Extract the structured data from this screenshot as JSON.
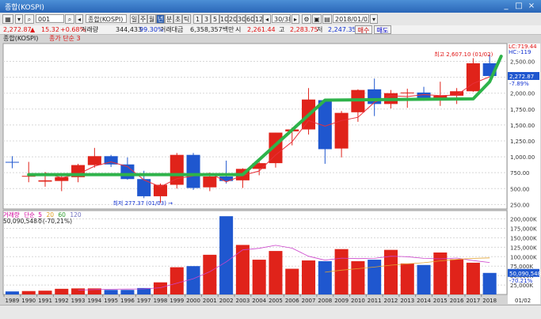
{
  "window": {
    "title": "종합(KOSPI)"
  },
  "toolbar": {
    "code_value": "001",
    "name_value": "종합(KOSPI)",
    "period_buttons": [
      "일",
      "주",
      "월",
      "년",
      "분",
      "초",
      "틱"
    ],
    "num_buttons": [
      "1",
      "3",
      "5",
      "10",
      "20",
      "30",
      "60",
      "120"
    ],
    "count_value": "30/38",
    "date_value": "2018/01/02"
  },
  "info": {
    "price": "2,272.87",
    "change_arrow": "▲",
    "change": "15.32",
    "pct": "+0.68%",
    "volume_label": "거래량",
    "volume": "344,433",
    "ratio": "99.30%",
    "amount_label": "거래대금",
    "amount": "6,358,357백만",
    "open_label": "시",
    "open": "2,261.44",
    "high_label": "고",
    "high": "2,283.75",
    "low_label": "저",
    "low": "2,247.35",
    "buy_button": "매수",
    "sell_button": "매도"
  },
  "legend": {
    "title": "종합(KOSPI)",
    "ma": "종가 단순 3"
  },
  "volume_legend": {
    "name": "거래량",
    "ma_label": "단순",
    "ma_periods": [
      "5",
      "20",
      "60",
      "120"
    ],
    "value": "50,090,548주(-70,21%)"
  },
  "annotations": {
    "max": "최고 2,607.10 (01/02)",
    "min": "최저 277.37 (01/03)",
    "lc": "LC:719.44",
    "hc": "HC:-119",
    "last_price": "2,272.87",
    "last_pct": "-7.89%",
    "vol_last": "50,090,548",
    "vol_pct": "-70.21%"
  },
  "colors": {
    "up": "#e0231a",
    "down": "#1f57cf",
    "trend": "#2eb34a",
    "ma": "#e8303a",
    "volma5": "#cc44cc",
    "volma20": "#e2a22e"
  },
  "chart_data": {
    "type": "candlestick",
    "x": [
      "1989",
      "1990",
      "1991",
      "1992",
      "1993",
      "1994",
      "1995",
      "1996",
      "1997",
      "1998",
      "1999",
      "2000",
      "2001",
      "2002",
      "2003",
      "2004",
      "2005",
      "2006",
      "2007",
      "2008",
      "2009",
      "2010",
      "2011",
      "2012",
      "2013",
      "2014",
      "2015",
      "2016",
      "2017",
      "2018"
    ],
    "open": [
      920,
      700,
      610,
      620,
      680,
      870,
      1010,
      880,
      650,
      380,
      560,
      1030,
      520,
      690,
      630,
      810,
      900,
      1400,
      1430,
      1890,
      1130,
      1700,
      2060,
      1830,
      2000,
      2010,
      1920,
      1960,
      2030,
      2470
    ],
    "close": [
      910,
      700,
      630,
      680,
      870,
      1010,
      880,
      650,
      380,
      560,
      1030,
      510,
      690,
      620,
      810,
      900,
      1380,
      1430,
      1900,
      1120,
      1690,
      2050,
      1830,
      2000,
      2010,
      1920,
      1960,
      2030,
      2470,
      2270
    ],
    "high": [
      1010,
      920,
      760,
      700,
      890,
      1140,
      1030,
      990,
      780,
      580,
      1060,
      1060,
      720,
      940,
      820,
      940,
      1380,
      1460,
      2080,
      1900,
      1720,
      2060,
      2230,
      2050,
      2070,
      2100,
      2180,
      2080,
      2550,
      2607
    ],
    "low": [
      820,
      600,
      530,
      460,
      600,
      830,
      840,
      640,
      350,
      277,
      500,
      480,
      460,
      580,
      510,
      710,
      830,
      1180,
      1350,
      890,
      990,
      1550,
      1640,
      1760,
      1770,
      1880,
      1800,
      1830,
      2020,
      2250
    ],
    "ma3": [
      null,
      null,
      747,
      670,
      727,
      853,
      920,
      847,
      637,
      530,
      657,
      700,
      743,
      607,
      707,
      777,
      1030,
      1237,
      1570,
      1483,
      1570,
      1620,
      1857,
      1960,
      1947,
      1977,
      1963,
      1970,
      2153,
      2257
    ],
    "volume": [
      8000,
      9000,
      10000,
      15000,
      16000,
      16000,
      12000,
      12000,
      17000,
      32000,
      72000,
      75000,
      105000,
      207000,
      131000,
      92000,
      115000,
      68000,
      90000,
      88000,
      120000,
      88000,
      92000,
      118000,
      82000,
      78000,
      111000,
      93000,
      84000,
      57000
    ],
    "vol_ma5": [
      null,
      null,
      null,
      null,
      11600,
      12800,
      13800,
      14200,
      14600,
      17800,
      29800,
      41600,
      60200,
      86200,
      118000,
      122000,
      130000,
      122600,
      101200,
      90600,
      96200,
      94800,
      95600,
      101200,
      100000,
      95600,
      94200,
      96400,
      89600,
      84600
    ],
    "vol_ma20": [
      null,
      null,
      null,
      null,
      null,
      null,
      null,
      null,
      null,
      null,
      null,
      null,
      null,
      null,
      null,
      null,
      null,
      null,
      null,
      58750,
      64350,
      68300,
      72400,
      77550,
      80850,
      83950,
      88900,
      92700,
      95450,
      96700
    ],
    "ylim": [
      180,
      2780
    ],
    "yticks": [
      250,
      500,
      750,
      1000,
      1250,
      1500,
      1750,
      2000,
      2250,
      2500
    ],
    "ytick_labels": [
      "250.00",
      "500.00",
      "750.00",
      "1,000.00",
      "1,250.00",
      "1,500.00",
      "1,750.00",
      "2,000.00",
      "2,250.00",
      "2,500.00"
    ],
    "vol_ylim": [
      0,
      222000
    ],
    "vol_yticks": [
      25000,
      50000,
      75000,
      100000,
      125000,
      150000,
      175000,
      200000
    ],
    "vol_ytick_labels": [
      "25,000K",
      "50,000K",
      "75,000K",
      "100,000K",
      "125,000K",
      "150,000K",
      "175,000K",
      "200,000K"
    ],
    "x_extra_label": "01/02",
    "trendline": [
      {
        "x": "1990",
        "y": 720
      },
      {
        "x": "2003",
        "y": 720
      },
      {
        "x": "2008",
        "y": 1890
      },
      {
        "x": "2017",
        "y": 1910
      },
      {
        "x": "2018",
        "y": 2180
      },
      {
        "x": "2018.7",
        "y": 2580
      }
    ]
  }
}
